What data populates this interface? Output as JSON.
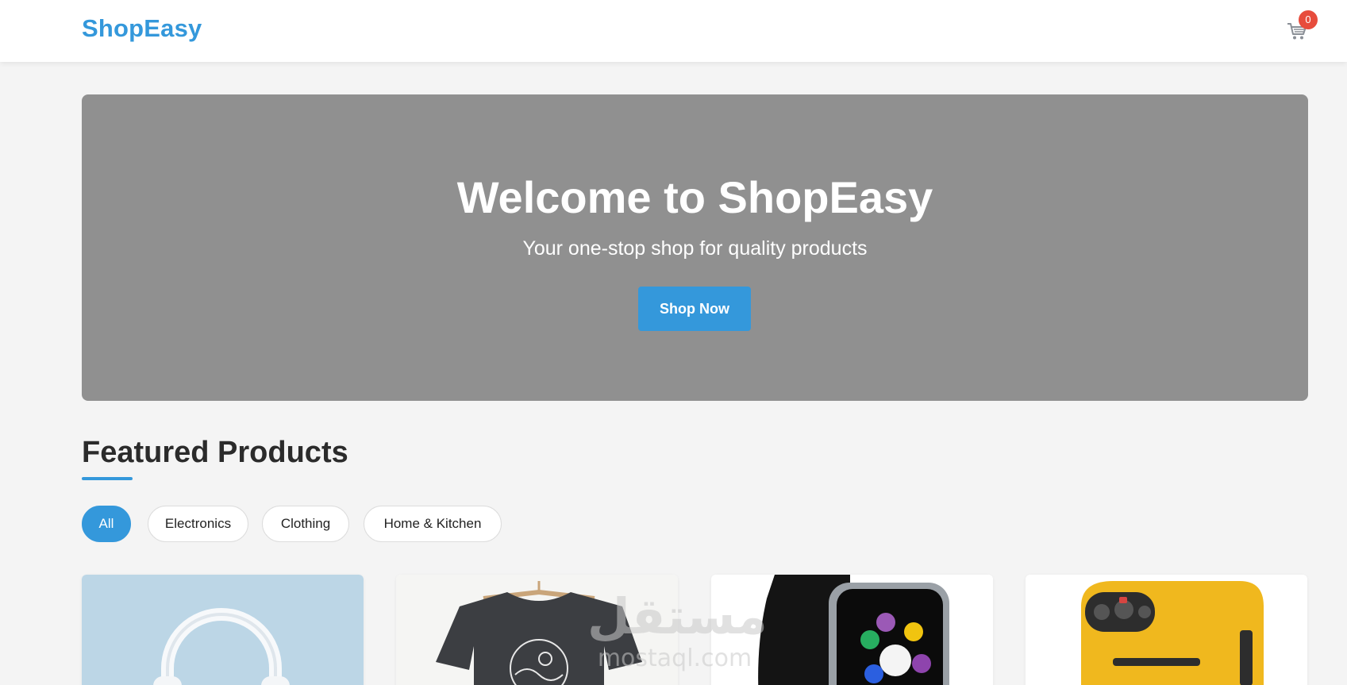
{
  "header": {
    "brand": "ShopEasy",
    "cart": {
      "icon": "cart-icon",
      "count": "0"
    }
  },
  "hero": {
    "title": "Welcome to ShopEasy",
    "subtitle": "Your one-stop shop for quality products",
    "cta_label": "Shop Now"
  },
  "featured": {
    "title": "Featured Products",
    "filters": [
      {
        "label": "All",
        "active": true
      },
      {
        "label": "Electronics",
        "active": false
      },
      {
        "label": "Clothing",
        "active": false
      },
      {
        "label": "Home & Kitchen",
        "active": false
      }
    ],
    "products": [
      {
        "image": "headphones-image"
      },
      {
        "image": "tshirt-image"
      },
      {
        "image": "smartwatch-image"
      },
      {
        "image": "coffee-machine-image"
      }
    ]
  },
  "watermark": {
    "arabic": "مستقل",
    "latin": "mostaql.com"
  },
  "colors": {
    "accent": "#3498db",
    "badge": "#e74c3c",
    "hero_bg": "#909090",
    "page_bg": "#f4f4f4"
  }
}
